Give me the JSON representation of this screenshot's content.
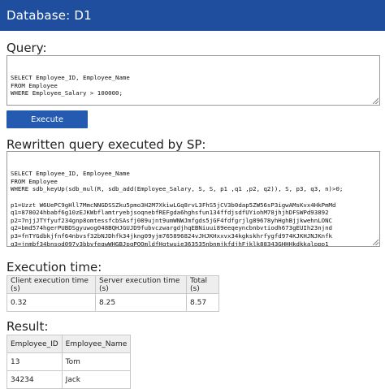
{
  "header": {
    "title": "Database: D1"
  },
  "query": {
    "label": "Query:",
    "lines": [
      "SELECT Employee_ID, Employee_Name",
      "FROM Employee",
      "WHERE Employee_Salary > 100000;"
    ]
  },
  "execute_button": {
    "label": "Execute"
  },
  "rewritten": {
    "label": "Rewritten query executed by SP:",
    "lines": [
      "SELECT Employee_ID, Employee_Name",
      "FROM Employee",
      "WHERE sdb_keyUp(sdb_mul(R, sdb_add(Employee_Salary, S, S, p1 ,q1 ,p2, q2)), S, p3, q3, n)>0;",
      "",
      "p1=Uzzt W6UePC9gHll7MmcNNGDSSZku5pmo3H2M7XkiwLGq8rvL3FhS5jCV3b0dap5ZW56sP3igwAMsKvx4HkPmMd",
      "q1=878024hbabf6g10zEJKWbflamtryebjsoqnebfREFgda6hghsfun134ffdjsdfUYiohM78jhjhDFSWPd93892",
      "p2=7njjJTYfyuf234gnp8omtessfcbSAsfj089ujnt9umWNWJmfgds5jGF4fdfgrjlg89678yhHghBjjkwehnLONC",
      "q2=bmd574hgerPUBDSgyuwog048BQHJGUJD9fubvczwargdjhqEBNiuui89eeqeyncbnbvtiodh673gEUIh23njnd",
      "p3=fnTYGdbkjfnf64nbvsf32bNJDhfk34jkng09yjm765896824vJHJKHxxvx34kgkskhrfygfd974KJKHJNJKnfk",
      "q3=jnmbf34bnsod097y3bbvfeqwWHGBJpqPOQmldfHqtwuie363535nbnmjkfdjhFjklk88343GHHHkdkkalppp1",
      "n=mnfbdbfqe08FDQWeknc bst4cvccn624hdjah5fsfhhfdjlHUJKHJKSH38bcvhrfdfUIH8978nJKlFQC8123Liq"
    ]
  },
  "execution_time": {
    "label": "Execution time:",
    "headers": [
      "Client execution time (s)",
      "Server execution time (s)",
      "Total (s)"
    ],
    "values": [
      "0.32",
      "8.25",
      "8.57"
    ]
  },
  "result": {
    "label": "Result:",
    "headers": [
      "Employee_ID",
      "Employee_Name"
    ],
    "rows": [
      [
        "13",
        "Tom"
      ],
      [
        "34234",
        "Jack"
      ]
    ]
  }
}
